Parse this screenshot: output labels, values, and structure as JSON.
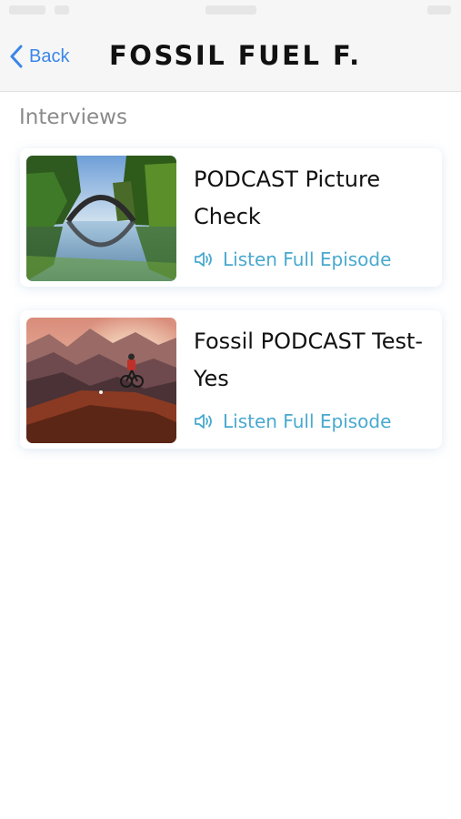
{
  "nav": {
    "back_label": "Back",
    "title": "FOSSIL FUEL F...",
    "accent_color": "#3a86e8"
  },
  "section": {
    "title": "Interviews"
  },
  "episodes": [
    {
      "title": "PODCAST Picture Check",
      "listen_label": "Listen Full Episode",
      "thumbnail_icon": "bridge-lake-photo"
    },
    {
      "title": "Fossil PODCAST Test-Yes",
      "listen_label": "Listen Full Episode",
      "thumbnail_icon": "mountain-cyclist-photo"
    }
  ],
  "colors": {
    "listen": "#48a9cf",
    "header_bg": "#f6f6f6"
  }
}
